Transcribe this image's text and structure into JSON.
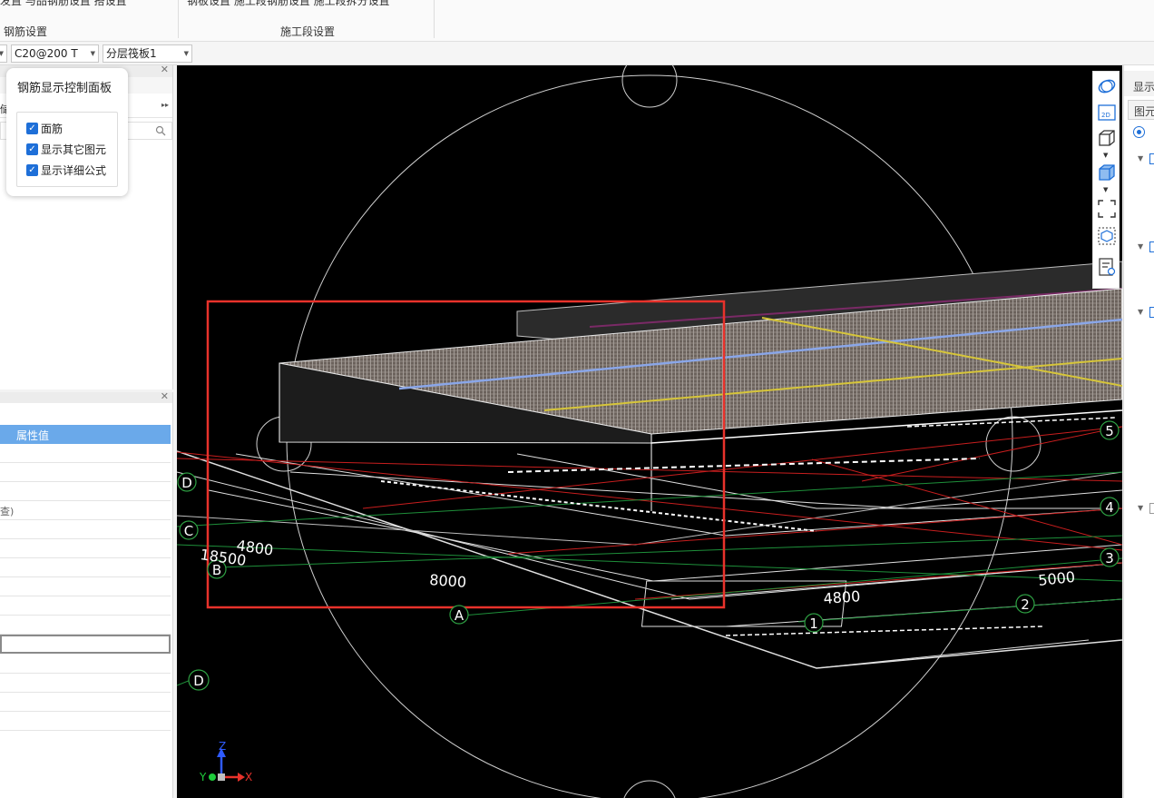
{
  "ribbon": {
    "cut_left_text": "发置  与品钢筋设置  搭设置",
    "cut_right_text": "钢板设置  施工段钢筋设置  施工段拆分设置",
    "group_rebar_settings": "钢筋设置",
    "group_section_settings": "施工段设置"
  },
  "toolbar": {
    "rebar_spec": "C20@200 T",
    "layer_slab": "分层筏板1"
  },
  "rebar_panel": {
    "title": "钢筋显示控制面板",
    "options": [
      {
        "label": "面筋",
        "checked": true
      },
      {
        "label": "显示其它图元",
        "checked": true
      },
      {
        "label": "显示详细公式",
        "checked": true
      }
    ]
  },
  "left_top_panel": {
    "cut_label": "储"
  },
  "property_panel": {
    "header_value": "属性值",
    "cut_row_text": "查)"
  },
  "viewport": {
    "axis_labels": [
      "D",
      "C",
      "B",
      "A",
      "D",
      "1",
      "2",
      "3",
      "4",
      "5"
    ],
    "dimensions": [
      "4800",
      "18500",
      "8000",
      "4800",
      "5000"
    ],
    "gizmo": {
      "z": "Z",
      "y": "Y",
      "x": "X"
    }
  },
  "right_panel": {
    "cut_title": "显示",
    "cut_tab": "图元"
  },
  "colors": {
    "highlight_red": "#e8322b",
    "accent_blue": "#1e6fd8",
    "axis_green": "#2ea043"
  }
}
